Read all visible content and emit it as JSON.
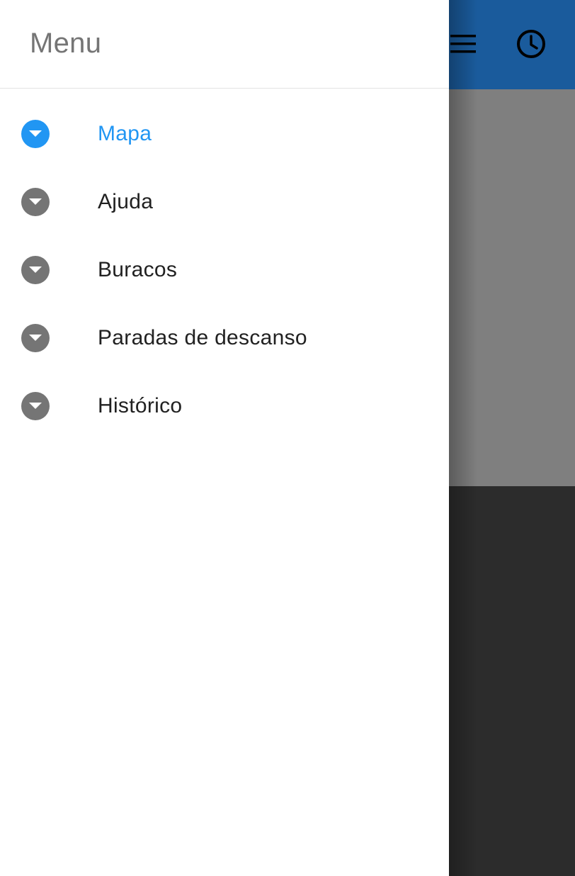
{
  "drawer": {
    "title": "Menu",
    "items": [
      {
        "label": "Mapa",
        "icon": "caret-down-circle-icon",
        "active": true
      },
      {
        "label": "Ajuda",
        "icon": "caret-down-circle-icon",
        "active": false
      },
      {
        "label": "Buracos",
        "icon": "caret-down-circle-icon",
        "active": false
      },
      {
        "label": "Paradas de descanso",
        "icon": "caret-down-circle-icon",
        "active": false
      },
      {
        "label": "Histórico",
        "icon": "caret-down-circle-icon",
        "active": false
      }
    ]
  },
  "toolbar": {
    "menu_icon": "hamburger-icon",
    "history_icon": "clock-icon"
  },
  "colors": {
    "accent": "#2196f3",
    "icon_inactive": "#757575",
    "toolbar": "#1a5b9c",
    "text": "#212121",
    "header_text": "#757575"
  }
}
